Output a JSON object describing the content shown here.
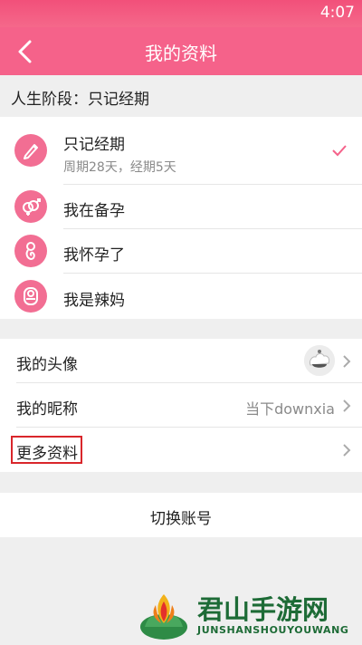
{
  "status_bar": {
    "time": "4:07"
  },
  "app_bar": {
    "title": "我的资料"
  },
  "stage_header": {
    "label": "人生阶段：只记经期"
  },
  "stages": [
    {
      "label": "只记经期",
      "sub": "周期28天，经期5天",
      "selected": true,
      "icon": "pencil-icon"
    },
    {
      "label": "我在备孕",
      "icon": "gender-rings-icon"
    },
    {
      "label": "我怀孕了",
      "icon": "fetus-icon"
    },
    {
      "label": "我是辣妈",
      "icon": "baby-icon"
    }
  ],
  "profile": {
    "avatar_label": "我的头像",
    "nickname_label": "我的昵称",
    "nickname_value": "当下downxia",
    "more_label": "更多资料"
  },
  "actions": {
    "switch_account": "切换账号"
  },
  "watermark": {
    "cn": "君山手游网",
    "en": "JUNSHANSHOUYOUWANG"
  },
  "colors": {
    "primary": "#f5628a",
    "highlight": "#d9262b",
    "watermark": "#1d6b36"
  }
}
